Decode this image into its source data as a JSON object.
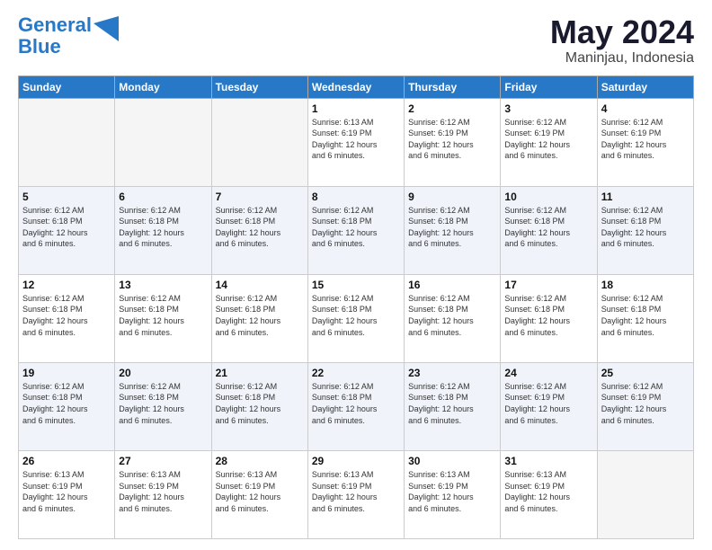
{
  "header": {
    "logo_line1": "General",
    "logo_line2": "Blue",
    "month_year": "May 2024",
    "location": "Maninjau, Indonesia"
  },
  "weekdays": [
    "Sunday",
    "Monday",
    "Tuesday",
    "Wednesday",
    "Thursday",
    "Friday",
    "Saturday"
  ],
  "weeks": [
    [
      {
        "day": "",
        "info": ""
      },
      {
        "day": "",
        "info": ""
      },
      {
        "day": "",
        "info": ""
      },
      {
        "day": "1",
        "info": "Sunrise: 6:13 AM\nSunset: 6:19 PM\nDaylight: 12 hours\nand 6 minutes."
      },
      {
        "day": "2",
        "info": "Sunrise: 6:12 AM\nSunset: 6:19 PM\nDaylight: 12 hours\nand 6 minutes."
      },
      {
        "day": "3",
        "info": "Sunrise: 6:12 AM\nSunset: 6:19 PM\nDaylight: 12 hours\nand 6 minutes."
      },
      {
        "day": "4",
        "info": "Sunrise: 6:12 AM\nSunset: 6:19 PM\nDaylight: 12 hours\nand 6 minutes."
      }
    ],
    [
      {
        "day": "5",
        "info": "Sunrise: 6:12 AM\nSunset: 6:18 PM\nDaylight: 12 hours\nand 6 minutes."
      },
      {
        "day": "6",
        "info": "Sunrise: 6:12 AM\nSunset: 6:18 PM\nDaylight: 12 hours\nand 6 minutes."
      },
      {
        "day": "7",
        "info": "Sunrise: 6:12 AM\nSunset: 6:18 PM\nDaylight: 12 hours\nand 6 minutes."
      },
      {
        "day": "8",
        "info": "Sunrise: 6:12 AM\nSunset: 6:18 PM\nDaylight: 12 hours\nand 6 minutes."
      },
      {
        "day": "9",
        "info": "Sunrise: 6:12 AM\nSunset: 6:18 PM\nDaylight: 12 hours\nand 6 minutes."
      },
      {
        "day": "10",
        "info": "Sunrise: 6:12 AM\nSunset: 6:18 PM\nDaylight: 12 hours\nand 6 minutes."
      },
      {
        "day": "11",
        "info": "Sunrise: 6:12 AM\nSunset: 6:18 PM\nDaylight: 12 hours\nand 6 minutes."
      }
    ],
    [
      {
        "day": "12",
        "info": "Sunrise: 6:12 AM\nSunset: 6:18 PM\nDaylight: 12 hours\nand 6 minutes."
      },
      {
        "day": "13",
        "info": "Sunrise: 6:12 AM\nSunset: 6:18 PM\nDaylight: 12 hours\nand 6 minutes."
      },
      {
        "day": "14",
        "info": "Sunrise: 6:12 AM\nSunset: 6:18 PM\nDaylight: 12 hours\nand 6 minutes."
      },
      {
        "day": "15",
        "info": "Sunrise: 6:12 AM\nSunset: 6:18 PM\nDaylight: 12 hours\nand 6 minutes."
      },
      {
        "day": "16",
        "info": "Sunrise: 6:12 AM\nSunset: 6:18 PM\nDaylight: 12 hours\nand 6 minutes."
      },
      {
        "day": "17",
        "info": "Sunrise: 6:12 AM\nSunset: 6:18 PM\nDaylight: 12 hours\nand 6 minutes."
      },
      {
        "day": "18",
        "info": "Sunrise: 6:12 AM\nSunset: 6:18 PM\nDaylight: 12 hours\nand 6 minutes."
      }
    ],
    [
      {
        "day": "19",
        "info": "Sunrise: 6:12 AM\nSunset: 6:18 PM\nDaylight: 12 hours\nand 6 minutes."
      },
      {
        "day": "20",
        "info": "Sunrise: 6:12 AM\nSunset: 6:18 PM\nDaylight: 12 hours\nand 6 minutes."
      },
      {
        "day": "21",
        "info": "Sunrise: 6:12 AM\nSunset: 6:18 PM\nDaylight: 12 hours\nand 6 minutes."
      },
      {
        "day": "22",
        "info": "Sunrise: 6:12 AM\nSunset: 6:18 PM\nDaylight: 12 hours\nand 6 minutes."
      },
      {
        "day": "23",
        "info": "Sunrise: 6:12 AM\nSunset: 6:18 PM\nDaylight: 12 hours\nand 6 minutes."
      },
      {
        "day": "24",
        "info": "Sunrise: 6:12 AM\nSunset: 6:19 PM\nDaylight: 12 hours\nand 6 minutes."
      },
      {
        "day": "25",
        "info": "Sunrise: 6:12 AM\nSunset: 6:19 PM\nDaylight: 12 hours\nand 6 minutes."
      }
    ],
    [
      {
        "day": "26",
        "info": "Sunrise: 6:13 AM\nSunset: 6:19 PM\nDaylight: 12 hours\nand 6 minutes."
      },
      {
        "day": "27",
        "info": "Sunrise: 6:13 AM\nSunset: 6:19 PM\nDaylight: 12 hours\nand 6 minutes."
      },
      {
        "day": "28",
        "info": "Sunrise: 6:13 AM\nSunset: 6:19 PM\nDaylight: 12 hours\nand 6 minutes."
      },
      {
        "day": "29",
        "info": "Sunrise: 6:13 AM\nSunset: 6:19 PM\nDaylight: 12 hours\nand 6 minutes."
      },
      {
        "day": "30",
        "info": "Sunrise: 6:13 AM\nSunset: 6:19 PM\nDaylight: 12 hours\nand 6 minutes."
      },
      {
        "day": "31",
        "info": "Sunrise: 6:13 AM\nSunset: 6:19 PM\nDaylight: 12 hours\nand 6 minutes."
      },
      {
        "day": "",
        "info": ""
      }
    ]
  ]
}
